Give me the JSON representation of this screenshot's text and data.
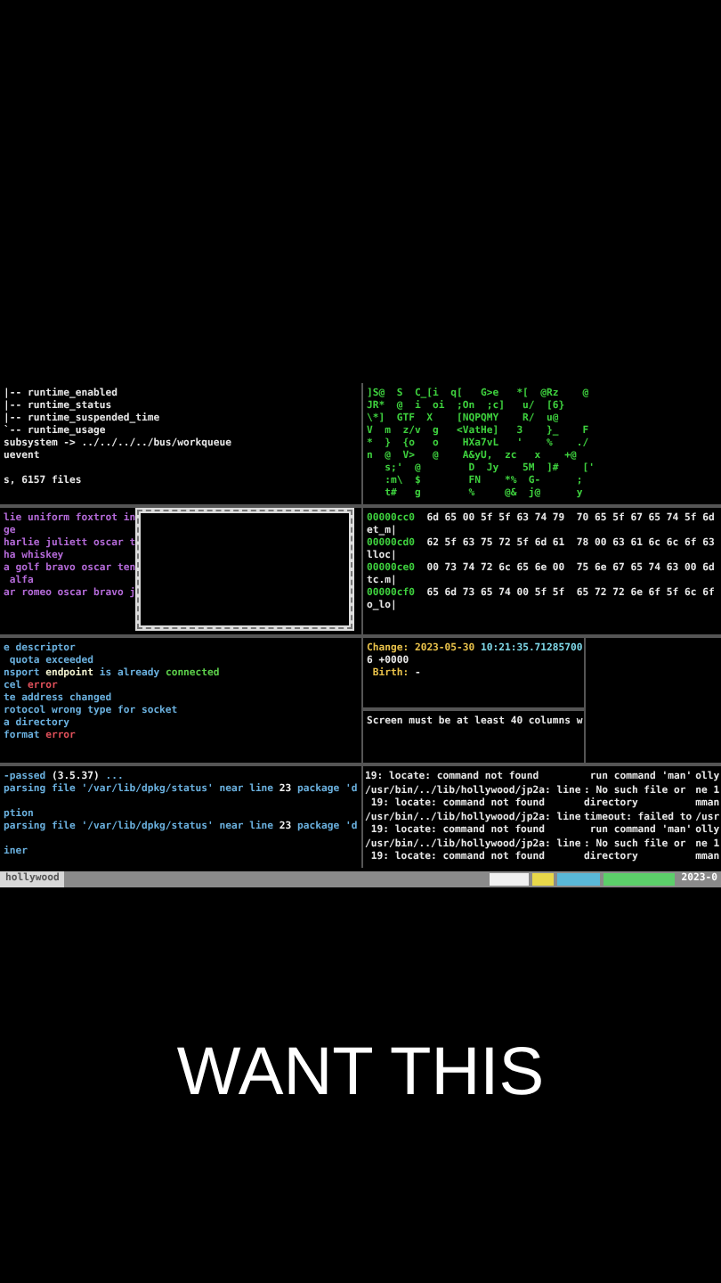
{
  "tree_pane": {
    "lines": [
      {
        "text": "|-- runtime_enabled",
        "blank_before": false
      },
      {
        "text": "|-- runtime_status",
        "blank_before": false
      },
      {
        "text": "|-- runtime_suspended_time",
        "blank_before": false
      },
      {
        "text": "`-- runtime_usage",
        "blank_before": false
      },
      {
        "text": "subsystem -> ../../../../bus/workqueue",
        "blank_before": false
      },
      {
        "text": "uevent",
        "blank_before": false
      },
      {
        "text": "s, 6157 files",
        "blank_before": true
      }
    ]
  },
  "matrix_pane": {
    "lines": [
      "]S@  S  C_[i  q[   G>e   *[  @Rz    @",
      "JR*  @  i  oi  ;On  ;c]   u/  [6}",
      "\\*]  GTF  X    [NQPQMY    R/  u@",
      "V  m  z/v  g   <VatHe]   3    }_    F",
      "*  }  {o   o    HXa7vL   '    %    ./",
      "n  @  V>   @    A&yU,  zc   x    +@",
      "   s;'  @        D  Jy    5M  ]#    ['",
      "   :m\\  $        FN    *%  G-      ;",
      "   t#   g        %     @&  j@      y"
    ]
  },
  "chat_pane": {
    "lines": [
      "lie uniform foxtrot in",
      "ge",
      "harlie juliett oscar t",
      "ha whiskey",
      "a golf bravo oscar ten",
      " alfa",
      "ar romeo oscar bravo j"
    ]
  },
  "hex_pane": {
    "rows": [
      {
        "address": "00000cc0",
        "bytes": "6d 65 00 5f 5f 63 74 79  70 65 5f 67 65 74 5f 6d",
        "ascii": "et_m|"
      },
      {
        "address": "00000cd0",
        "bytes": "62 5f 63 75 72 5f 6d 61  78 00 63 61 6c 6c 6f 63",
        "ascii": "lloc|"
      },
      {
        "address": "00000ce0",
        "bytes": "00 73 74 72 6c 65 6e 00  75 6e 67 65 74 63 00 6d",
        "ascii": "tc.m|"
      },
      {
        "address": "00000cf0",
        "bytes": "65 6d 73 65 74 00 5f 5f  65 72 72 6e 6f 5f 6c 6f",
        "ascii": "o_lo|"
      }
    ]
  },
  "error_pane": {
    "lines": [
      {
        "segments": [
          {
            "text": "e descriptor",
            "color": "#6ab0de"
          }
        ]
      },
      {
        "segments": [
          {
            "text": " quota exceeded",
            "color": "#6ab0de"
          }
        ]
      },
      {
        "segments": [
          {
            "text": "nsport ",
            "color": "#6ab0de"
          },
          {
            "text": "endpoint",
            "color": "#f2f2d0"
          },
          {
            "text": " is already ",
            "color": "#6ab0de"
          },
          {
            "text": "connected",
            "color": "#5ccf4a"
          }
        ]
      },
      {
        "segments": [
          {
            "text": "cel ",
            "color": "#6ab0de"
          },
          {
            "text": "error",
            "color": "#e0505a"
          }
        ]
      },
      {
        "segments": [
          {
            "text": "te address changed",
            "color": "#6ab0de"
          }
        ]
      },
      {
        "segments": [
          {
            "text": "rotocol wrong type for socket",
            "color": "#6ab0de"
          }
        ]
      },
      {
        "segments": [
          {
            "text": "a directory",
            "color": "#6ab0de"
          }
        ]
      },
      {
        "segments": [
          {
            "text": "format ",
            "color": "#6ab0de"
          },
          {
            "text": "error",
            "color": "#e0505a"
          }
        ]
      }
    ]
  },
  "stat_pane": {
    "lines": [
      {
        "segments": [
          {
            "text": "Change: ",
            "color": "#e8c14a"
          },
          {
            "text": "2023-05-30 ",
            "color": "#e8c14a"
          },
          {
            "text": "10:21:35.71285700",
            "color": "#7fd8e8"
          }
        ]
      },
      {
        "segments": [
          {
            "text": "6 +0000",
            "color": "#e8e8e8"
          }
        ]
      },
      {
        "segments": [
          {
            "text": " Birth: ",
            "color": "#e8c14a"
          },
          {
            "text": "-",
            "color": "#e8e8e8"
          }
        ]
      }
    ]
  },
  "message_pane": {
    "text": "Screen must be at least 40 columns w"
  },
  "dpkg_pane": {
    "lines": [
      {
        "segments": [
          {
            "text": "-passed ",
            "color": "#6ab0de"
          },
          {
            "text": "(3.5.37)",
            "color": "#f2f2f2"
          },
          {
            "text": " ...",
            "color": "#6ab0de"
          }
        ],
        "blank_before": false
      },
      {
        "segments": [
          {
            "text": "parsing file '/var/lib/dpkg/status' near line ",
            "color": "#6ab0de"
          },
          {
            "text": "23",
            "color": "#f2f2f2"
          },
          {
            "text": " package 'd",
            "color": "#6ab0de"
          }
        ],
        "blank_before": false
      },
      {
        "segments": [
          {
            "text": "ption",
            "color": "#6ab0de"
          }
        ],
        "blank_before": true
      },
      {
        "segments": [
          {
            "text": "parsing file '/var/lib/dpkg/status' near line ",
            "color": "#6ab0de"
          },
          {
            "text": "23",
            "color": "#f2f2f2"
          },
          {
            "text": " package 'd",
            "color": "#6ab0de"
          }
        ],
        "blank_before": false
      },
      {
        "segments": [
          {
            "text": "iner",
            "color": "#6ab0de"
          }
        ],
        "blank_before": true
      }
    ]
  },
  "locate_pane": {
    "columns": [
      {
        "lines": [
          "19: locate: command not found",
          "/usr/bin/../lib/hollywood/jp2a: line",
          " 19: locate: command not found",
          "/usr/bin/../lib/hollywood/jp2a: line",
          " 19: locate: command not found",
          "/usr/bin/../lib/hollywood/jp2a: line",
          " 19: locate: command not found"
        ]
      },
      {
        "lines": [
          " run command 'man'",
          ": No such file or",
          "directory",
          "timeout: failed to",
          " run command 'man'",
          ": No such file or",
          "directory"
        ]
      },
      {
        "lines": [
          "olly",
          "ne 1",
          "mman",
          "/usr",
          "olly",
          "ne 1",
          "mman"
        ]
      }
    ]
  },
  "status_bar": {
    "session": "hollywood",
    "segments": [
      {
        "color": "#f0f0f0"
      },
      {
        "color": "#e8d84a"
      },
      {
        "color": "#5ab8d8"
      },
      {
        "color": "#5ccf6a"
      }
    ],
    "clock": "2023-0"
  },
  "caption": "WANT THIS"
}
